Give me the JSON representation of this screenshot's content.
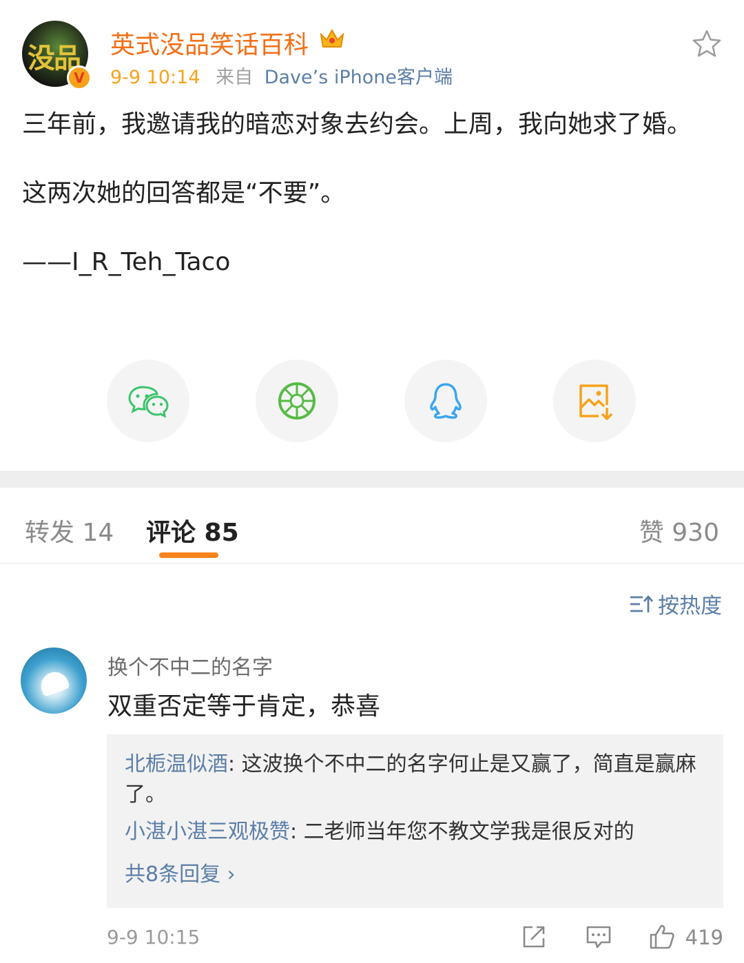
{
  "post": {
    "username": "英式没品笑话百科",
    "avatar_text": "没品",
    "verified_badge": "V",
    "time": "9-9 10:14",
    "source_prefix": "来自",
    "source": "Dave’s iPhone客户端",
    "icons": {
      "crown": "crown-icon",
      "favorite": "star-icon"
    },
    "body": {
      "line1": "三年前，我邀请我的暗恋对象去约会。上周，我向她求了婚。",
      "line2": "这两次她的回答都是“不要”。",
      "line3": "——I_R_Teh_Taco"
    }
  },
  "share": {
    "buttons": [
      {
        "name": "wechat",
        "icon": "wechat-icon",
        "color": "#3cc36b"
      },
      {
        "name": "moments",
        "icon": "moments-icon",
        "color": "#55bb45"
      },
      {
        "name": "qq",
        "icon": "qq-icon",
        "color": "#3ba5f3"
      },
      {
        "name": "save-image",
        "icon": "save-image-icon",
        "color": "#f7a21b"
      }
    ]
  },
  "tabs": {
    "repost": "转发 14",
    "comments": "评论 85",
    "likes": "赞 930",
    "active_color": "#f7831b"
  },
  "sort": {
    "label": "按热度",
    "icon": "sort-icon"
  },
  "comment": {
    "author": "换个不中二的名字",
    "text": "双重否定等于肯定，恭喜",
    "replies": [
      {
        "name": "北栀温似酒",
        "sep": ": ",
        "text": "这波换个不中二的名字何止是又赢了，简直是赢麻了。"
      },
      {
        "name": "小湛小湛三观极赞",
        "sep": ": ",
        "text": "二老师当年您不教文学我是很反对的"
      }
    ],
    "more_replies": "共8条回复 ›",
    "time": "9-9 10:15",
    "like_count": "419",
    "icons": {
      "share": "share-icon",
      "reply": "comment-icon",
      "like": "thumbs-up-icon"
    }
  }
}
